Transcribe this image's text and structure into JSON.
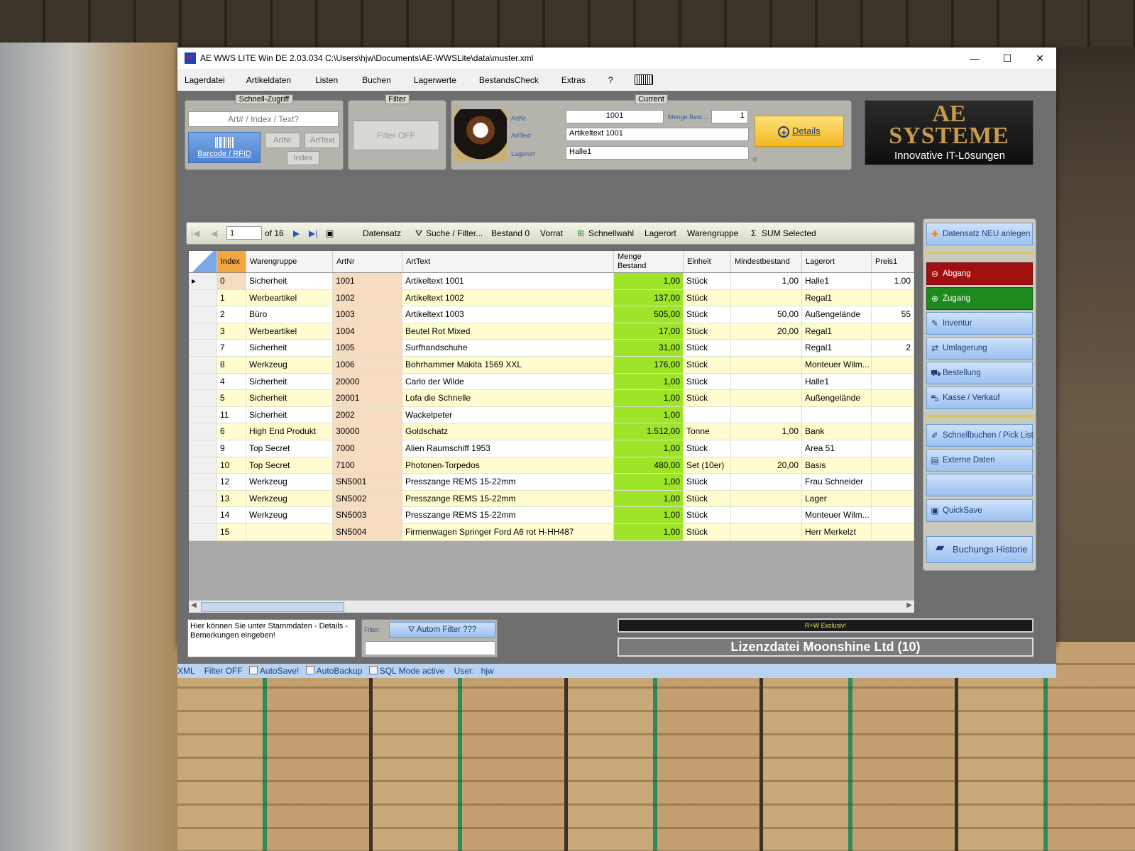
{
  "window": {
    "title": "AE WWS LITE Win DE 2.03.034 C:\\Users\\hjw\\Documents\\AE-WWSLite\\data\\muster.xml",
    "app_icon_text": "AE",
    "minimize": "—",
    "maximize": "☐",
    "close": "✕"
  },
  "menu": [
    "Lagerdatei",
    "Artikeldaten",
    "Listen",
    "Buchen",
    "Lagerwerte",
    "BestandsCheck",
    "Extras",
    "?"
  ],
  "quick_access": {
    "title": "Schnell-Zugriff",
    "placeholder": "Art# / Index / Text?",
    "barcode_label": "Barcode / RFID",
    "artnr_label": "ArtNr",
    "arttext_label": "ArtText",
    "index_label": "Index"
  },
  "filter_group": {
    "title": "Filter",
    "button": "Filter OFF"
  },
  "current": {
    "title": "Current",
    "artnr_label": "ArtNr",
    "artnr_value": "1001",
    "menge_label": "Menge Best...",
    "menge_value": "1",
    "arttext_label": "ArtText",
    "arttext_value": "Artikeltext 1001",
    "lagerort_label": "Lagerort",
    "lagerort_value": "Halle1",
    "details_label": "Details",
    "small_zero": "0"
  },
  "logo": {
    "line1": "AE",
    "line2": "SYSTEME",
    "tagline": "Innovative IT-Lösungen"
  },
  "navigator": {
    "position": "1",
    "of_label": "of 16"
  },
  "toolbar": {
    "datensatz": "Datensatz",
    "suche": "Suche / Filter...",
    "bestand0": "Bestand 0",
    "vorrat": "Vorrat",
    "schnellwahl": "Schnellwahl",
    "lagerort": "Lagerort",
    "warengruppe": "Warengruppe",
    "sum": "SUM Selected"
  },
  "grid": {
    "headers": [
      "Index",
      "Warengruppe",
      "ArtNr",
      "ArtText",
      "Menge Bestand",
      "Einheit",
      "Mindestbestand",
      "Lagerort",
      "Preis1"
    ],
    "header_menge_line1": "Menge",
    "header_menge_line2": "Bestand",
    "rows": [
      {
        "idx": "0",
        "wg": "Sicherheit",
        "artnr": "1001",
        "text": "Artikeltext 1001",
        "menge": "1,00",
        "einheit": "Stück",
        "min": "1,00",
        "lager": "Halle1",
        "preis": "1.00"
      },
      {
        "idx": "1",
        "wg": "Werbeartikel",
        "artnr": "1002",
        "text": "Artikeltext 1002",
        "menge": "137,00",
        "einheit": "Stück",
        "min": "",
        "lager": "Regal1",
        "preis": ""
      },
      {
        "idx": "2",
        "wg": "Büro",
        "artnr": "1003",
        "text": "Artikeltext 1003",
        "menge": "505,00",
        "einheit": "Stück",
        "min": "50,00",
        "lager": "Außengelände",
        "preis": "55"
      },
      {
        "idx": "3",
        "wg": "Werbeartikel",
        "artnr": "1004",
        "text": "Beutel Rot Mixed",
        "menge": "17,00",
        "einheit": "Stück",
        "min": "20,00",
        "lager": "Regal1",
        "preis": ""
      },
      {
        "idx": "7",
        "wg": "Sicherheit",
        "artnr": "1005",
        "text": "Surfhandschuhe",
        "menge": "31,00",
        "einheit": "Stück",
        "min": "",
        "lager": "Regal1",
        "preis": "2"
      },
      {
        "idx": "8",
        "wg": "Werkzeug",
        "artnr": "1006",
        "text": "Bohrhammer Makita 1569 XXL",
        "menge": "176,00",
        "einheit": "Stück",
        "min": "",
        "lager": "Monteuer Wilm...",
        "preis": ""
      },
      {
        "idx": "4",
        "wg": "Sicherheit",
        "artnr": "20000",
        "text": "Carlo der Wilde",
        "menge": "1,00",
        "einheit": "Stück",
        "min": "",
        "lager": "Halle1",
        "preis": ""
      },
      {
        "idx": "5",
        "wg": "Sicherheit",
        "artnr": "20001",
        "text": "Lofa die Schnelle",
        "menge": "1,00",
        "einheit": "Stück",
        "min": "",
        "lager": "Außengelände",
        "preis": ""
      },
      {
        "idx": "11",
        "wg": "Sicherheit",
        "artnr": "2002",
        "text": "Wackelpeter",
        "menge": "1,00",
        "einheit": "",
        "min": "",
        "lager": "",
        "preis": ""
      },
      {
        "idx": "6",
        "wg": "High End Produkt",
        "artnr": "30000",
        "text": "Goldschatz",
        "menge": "1.512,00",
        "einheit": "Tonne",
        "min": "1,00",
        "lager": "Bank",
        "preis": ""
      },
      {
        "idx": "9",
        "wg": "Top Secret",
        "artnr": "7000",
        "text": "Alien Raumschiff 1953",
        "menge": "1,00",
        "einheit": "Stück",
        "min": "",
        "lager": "Area 51",
        "preis": ""
      },
      {
        "idx": "10",
        "wg": "Top Secret",
        "artnr": "7100",
        "text": "Photonen-Torpedos",
        "menge": "480,00",
        "einheit": "Set (10er)",
        "min": "20,00",
        "lager": "Basis",
        "preis": ""
      },
      {
        "idx": "12",
        "wg": "Werkzeug",
        "artnr": "SN5001",
        "text": "Presszange REMS 15-22mm",
        "menge": "1,00",
        "einheit": "Stück",
        "min": "",
        "lager": "Frau Schneider",
        "preis": ""
      },
      {
        "idx": "13",
        "wg": "Werkzeug",
        "artnr": "SN5002",
        "text": "Presszange REMS 15-22mm",
        "menge": "1,00",
        "einheit": "Stück",
        "min": "",
        "lager": "Lager",
        "preis": ""
      },
      {
        "idx": "14",
        "wg": "Werkzeug",
        "artnr": "SN5003",
        "text": "Presszange REMS 15-22mm",
        "menge": "1,00",
        "einheit": "Stück",
        "min": "",
        "lager": "Monteuer Wilm...",
        "preis": ""
      },
      {
        "idx": "15",
        "wg": "",
        "artnr": "SN5004",
        "text": "Firmenwagen Springer Ford A6 rot H-HH487",
        "menge": "1,00",
        "einheit": "Stück",
        "min": "",
        "lager": "Herr Merkelzt",
        "preis": ""
      }
    ]
  },
  "side_buttons": {
    "neu": "Datensatz NEU anlegen",
    "abgang": "Abgang",
    "zugang": "Zugang",
    "inventur": "Inventur",
    "umlagerung": "Umlagerung",
    "bestellung": "Bestellung",
    "kasse": "Kasse / Verkauf",
    "schnellbuchen": "Schnellbuchen / Pick List",
    "externe": "Externe Daten",
    "quicksave": "QuickSave",
    "historie": "Buchungs Historie"
  },
  "bottom": {
    "notes": "Hier können Sie unter Stammdaten - Details - Bemerkungen eingeben!",
    "filter_label": "Filter:",
    "autom_filter": "Autom Filter ???",
    "rw_text": "R+W Exclusiv!",
    "license": "Lizenzdatei Moonshine Ltd (10)"
  },
  "status": {
    "xml": "XML",
    "filter": "Filter OFF",
    "autosave": "AutoSave!",
    "autobackup": "AutoBackup",
    "sql": "SQL Mode active",
    "user_label": "User:",
    "user": "hjw"
  },
  "colors": {
    "menge_green": "#9ee52a",
    "row_yellow": "#fffdd0",
    "artnr_tan": "#f6dcc0",
    "abgang_red": "#a01010",
    "zugang_green": "#1e8a1e",
    "details_gold": "#f2c030"
  }
}
